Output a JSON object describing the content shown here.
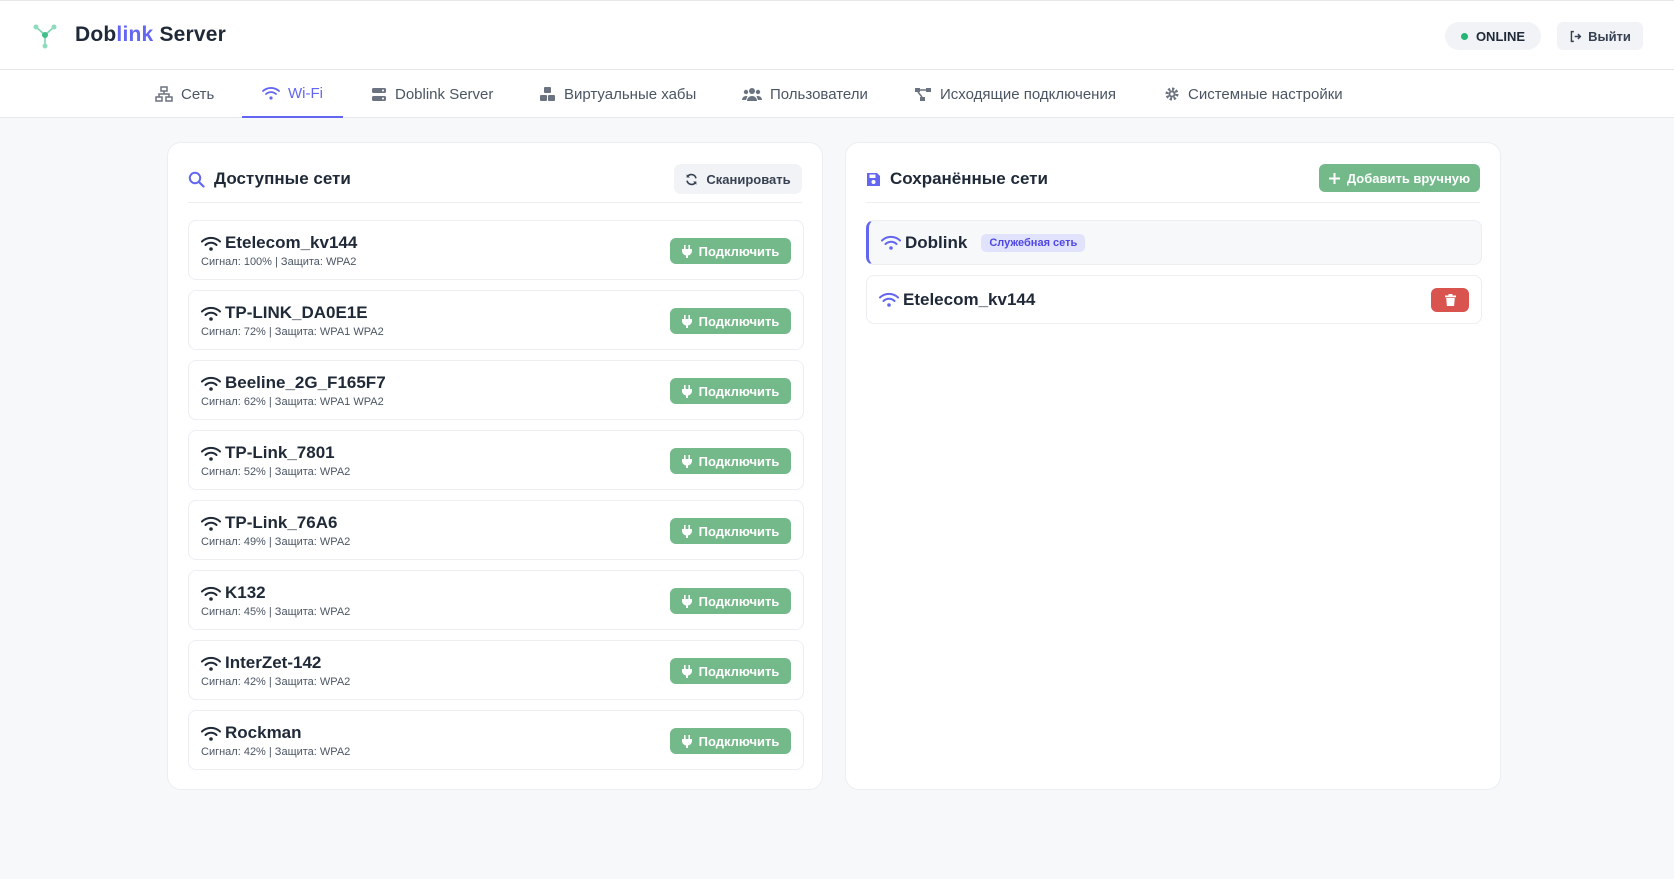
{
  "header": {
    "brand_part1": "Dob",
    "brand_part2": "link",
    "brand_part3": " Server",
    "status": "ONLINE",
    "logout_label": "Выйти"
  },
  "tabs": [
    {
      "label": "Сеть",
      "icon": "network-icon"
    },
    {
      "label": "Wi-Fi",
      "icon": "wifi-icon",
      "active": true
    },
    {
      "label": "Doblink Server",
      "icon": "server-icon"
    },
    {
      "label": "Виртуальные хабы",
      "icon": "cubes-icon"
    },
    {
      "label": "Пользователи",
      "icon": "users-icon"
    },
    {
      "label": "Исходящие подключения",
      "icon": "project-diagram-icon"
    },
    {
      "label": "Системные настройки",
      "icon": "gear-icon"
    }
  ],
  "available": {
    "title": "Доступные сети",
    "scan_label": "Сканировать",
    "networks": [
      {
        "name": "Etelecom_kv144",
        "meta": "Сигнал: 100% | Защита: WPA2",
        "button": "Подключить"
      },
      {
        "name": "TP-LINK_DA0E1E",
        "meta": "Сигнал: 72% | Защита: WPA1 WPA2",
        "button": "Подключить"
      },
      {
        "name": "Beeline_2G_F165F7",
        "meta": "Сигнал: 62% | Защита: WPA1 WPA2",
        "button": "Подключить"
      },
      {
        "name": "TP-Link_7801",
        "meta": "Сигнал: 52% | Защита: WPA2",
        "button": "Подключить"
      },
      {
        "name": "TP-Link_76A6",
        "meta": "Сигнал: 49% | Защита: WPA2",
        "button": "Подключить"
      },
      {
        "name": "K132",
        "meta": "Сигнал: 45% | Защита: WPA2",
        "button": "Подключить"
      },
      {
        "name": "InterZet-142",
        "meta": "Сигнал: 42% | Защита: WPA2",
        "button": "Подключить"
      },
      {
        "name": "Rockman",
        "meta": "Сигнал: 42% | Защита: WPA2",
        "button": "Подключить"
      }
    ]
  },
  "saved": {
    "title": "Сохранённые сети",
    "add_label": "Добавить вручную",
    "networks": [
      {
        "name": "Doblink",
        "badge": "Служебная сеть"
      },
      {
        "name": "Etelecom_kv144"
      }
    ]
  },
  "colors": {
    "accent": "#6366f1",
    "success": "#74b98a",
    "danger": "#d9534f",
    "online_dot": "#22b573"
  }
}
